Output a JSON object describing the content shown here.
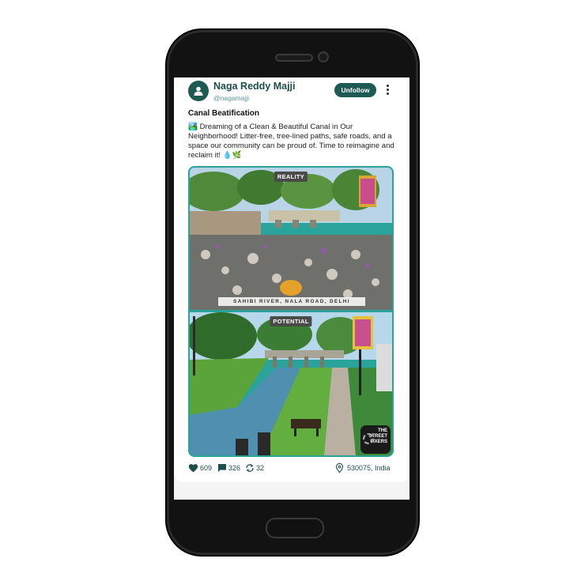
{
  "post": {
    "author_name": "Naga Reddy Majji",
    "author_handle": "@nagamajji",
    "follow_button_label": "Unfollow",
    "title": "Canal Beatification",
    "body": "🏞️ Dreaming of a Clean & Beautiful Canal in Our Neighborhood! Litter-free, tree-lined paths, safe roads, and a space our community can be proud of. Time to reimagine and reclaim it! 💧🌿",
    "image": {
      "top_label": "REALITY",
      "bottom_label": "POTENTIAL",
      "location_caption": "SAHIBI RIVER, NALA ROAD, DELHI",
      "badge_lines": [
        "THE",
        "STREET",
        "FIXERS"
      ]
    },
    "stats": {
      "likes": "609",
      "comments": "326",
      "reposts": "32",
      "location": "530075, India"
    }
  },
  "icons": {
    "avatar": "user-icon",
    "more": "more-vertical-icon",
    "like": "heart-icon",
    "comment": "comment-icon",
    "repost": "repost-icon",
    "location": "map-pin-icon"
  },
  "colors": {
    "accent": "#1e5a54",
    "image_border": "#2aa39a",
    "phone_body": "#121212"
  }
}
